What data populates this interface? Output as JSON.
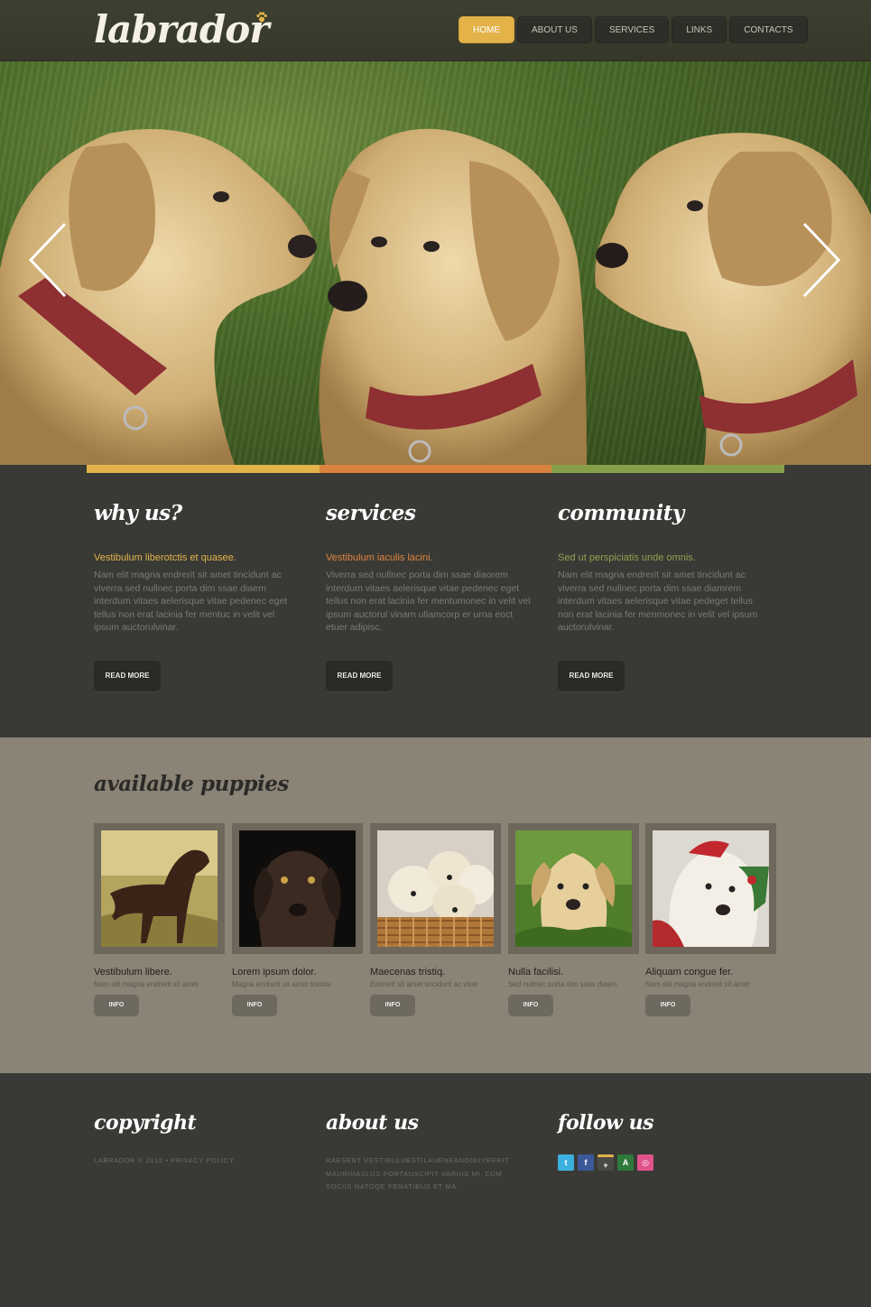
{
  "header": {
    "logo": "labrador",
    "nav": [
      {
        "label": "HOME",
        "active": true
      },
      {
        "label": "ABOUT US",
        "active": false
      },
      {
        "label": "SERVICES",
        "active": false
      },
      {
        "label": "LINKS",
        "active": false
      },
      {
        "label": "CONTACTS",
        "active": false
      }
    ]
  },
  "colors": {
    "accent_yellow": "#e3b34a",
    "accent_orange": "#d9833e",
    "accent_green": "#86a04a"
  },
  "features": [
    {
      "title": "why us?",
      "subtitle": "Vestibulum liberotctis et quasee.",
      "subtitle_color": "#e3b34a",
      "body": "Nam elit magna endrerit sit amet tincidunt ac viverra sed nullnec porta dim ssae diaem interdum vitaes aelerisque vitae pedenec eget tellus non erat lacinia fer mentuc in velit vel ipsum auctorulvinar.",
      "button": "READ MORE"
    },
    {
      "title": "services",
      "subtitle": "Vestibulum iaculis lacini.",
      "subtitle_color": "#e0833f",
      "body": "Viverra sed nullnec porta dim ssae diaorem interdum vitaes aelerisque vitae pedenec eget tellus non erat lacinia fer mentumonec in velit vel ipsum auctorul vinarn ullamcorp er urna eoct etuer adipisc.",
      "button": "READ MORE"
    },
    {
      "title": "community",
      "subtitle": "Sed ut perspiciatis unde omnis.",
      "subtitle_color": "#8ea24f",
      "body": "Nam elit magna endrerit sit amet tincidunt ac viverra sed nullnec porta dim ssae diamrem interdum vitaes aelerisque vitae pedeget tellus non erat lacinia fer menmonec in velit vel ipsum auctorulvinar.",
      "button": "READ MORE"
    }
  ],
  "puppies": {
    "title": "available puppies",
    "items": [
      {
        "title": "Vestibulum libere.",
        "desc": "Nam elit magna endrerit sit amet",
        "button": "INFO"
      },
      {
        "title": "Lorem ipsum dolor.",
        "desc": "Magna endrerit sit amet tincidu",
        "button": "INFO"
      },
      {
        "title": "Maecenas tristiq.",
        "desc": "Endrerit sit amet tincidunt ac viver",
        "button": "INFO"
      },
      {
        "title": "Nulla facilisi.",
        "desc": "Sed nullnec porta dim ssae diaem",
        "button": "INFO"
      },
      {
        "title": "Aliquam congue fer.",
        "desc": "Nam elit magna endrerit sit amet",
        "button": "INFO"
      }
    ]
  },
  "footer": {
    "copyright_title": "copyright",
    "copyright_text": "LABRADOR © 2012 • PRIVACY POLICY",
    "about_title": "about us",
    "about_text": "RAESENT VESTIBULUESTILAUENEANONUYRERIT MAURIHASLUS PORTAUSCIPIT VARIUS MI. CUM SOCIIS NATOQE PENATIBUS ET MA.",
    "follow_title": "follow us",
    "social": [
      {
        "icon": "twitter-icon",
        "glyph": "t",
        "color": "#3bb0e0"
      },
      {
        "icon": "facebook-icon",
        "glyph": "f",
        "color": "#3b5998"
      },
      {
        "icon": "google-plus-icon",
        "glyph": "+",
        "color": "#4a4a44"
      },
      {
        "icon": "vine-icon",
        "glyph": "A",
        "color": "#2f7a3a"
      },
      {
        "icon": "dribbble-icon",
        "glyph": "◎",
        "color": "#e0528a"
      }
    ]
  }
}
